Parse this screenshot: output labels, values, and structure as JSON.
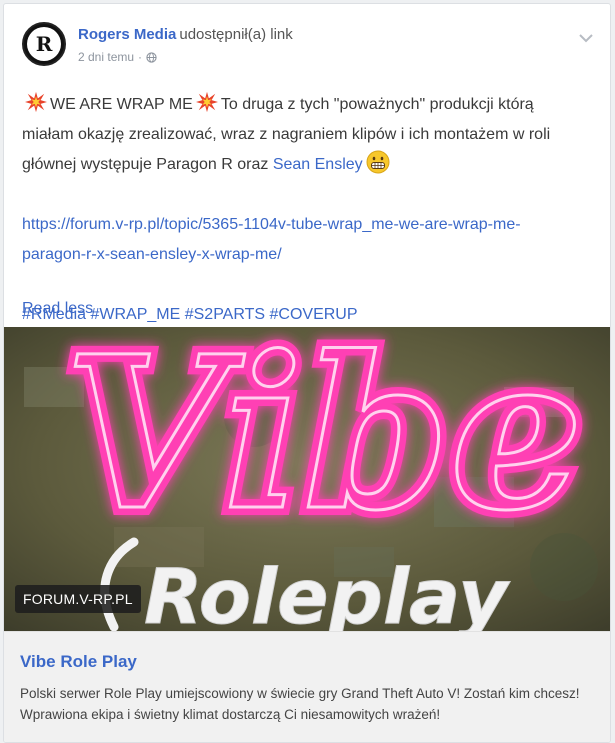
{
  "post": {
    "author": "Rogers Media",
    "action": "udostępnił(a) link",
    "time": "2 dni temu",
    "avatar_text": "R",
    "headline": "WE ARE WRAP ME",
    "body_line_1": "To druga z tych \"poważnych\" produkcji którą",
    "body_line_2": "miałam okazję zrealizować, wraz z nagraniem klipów i ich montażem w roli",
    "body_line_3_prefix": "głównej występuje Paragon R oraz",
    "mention": "Sean Ensley",
    "url_line_1": "https://forum.v-rp.pl/topic/5365-1104v-tube-wrap_me-we-are-wrap-me-",
    "url_line_2": "paragon-r-x-sean-ensley-x-wrap-me/",
    "hashtags": "#RMedia #WRAP_ME #S2PARTS #COVERUP",
    "read_less": "Read less"
  },
  "preview": {
    "domain": "FORUM.V-RP.PL",
    "image_word_1": "Vibe",
    "image_word_2": "Roleplay",
    "title": "Vibe Role Play",
    "description": "Polski serwer Role Play umiejscowiony w świecie gry Grand Theft Auto V! Zostań kim chcesz! Wprawiona ekipa i świetny klimat dostarczą Ci niesamowitych wrażeń!"
  },
  "colors": {
    "link": "#3b68c8",
    "neon_pink": "#ff3fb4",
    "card_bg": "#ffffff",
    "footer_bg": "#f1f1f1"
  },
  "icons": [
    "collision-emoji",
    "grimacing-emoji",
    "globe-icon",
    "chevron-down-icon"
  ]
}
